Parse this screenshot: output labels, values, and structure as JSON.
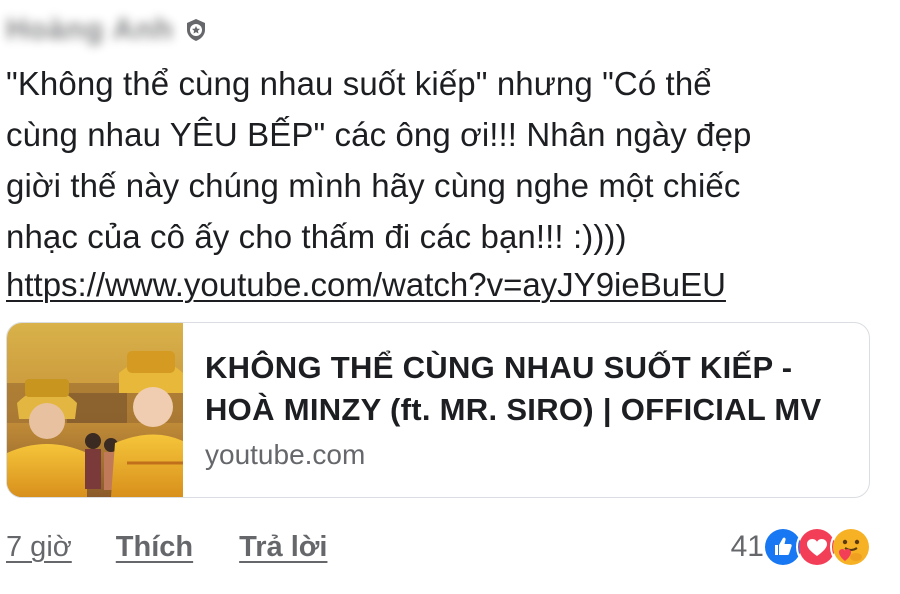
{
  "comment": {
    "author_name": "Hoàng Anh",
    "text": "\"Không thể cùng nhau suốt kiếp\" nhưng \"Có thể\ncùng nhau YÊU BẾP\" các ông ơi!!! Nhân ngày đẹp\ngiời thế này chúng mình hãy cùng nghe một chiếc\nnhạc của cô ấy cho thấm đi các bạn!!! :))))",
    "link_url": "https://www.youtube.com/watch?v=ayJY9ieBuEU"
  },
  "link_preview": {
    "title": "KHÔNG THỂ CÙNG NHAU SUỐT KIẾP - HOÀ MINZY (ft. MR. SIRO) | OFFICIAL MV",
    "domain": "youtube.com"
  },
  "footer": {
    "time": "7 giờ",
    "like_label": "Thích",
    "reply_label": "Trả lời",
    "reaction_count": "41",
    "reactions": [
      "like-icon",
      "love-icon",
      "care-icon"
    ]
  },
  "colors": {
    "text": "#1c1e21",
    "secondary": "#65676b",
    "like_blue": "#1877f2",
    "love_red": "#f33e58",
    "care_yellow": "#f7b125"
  }
}
